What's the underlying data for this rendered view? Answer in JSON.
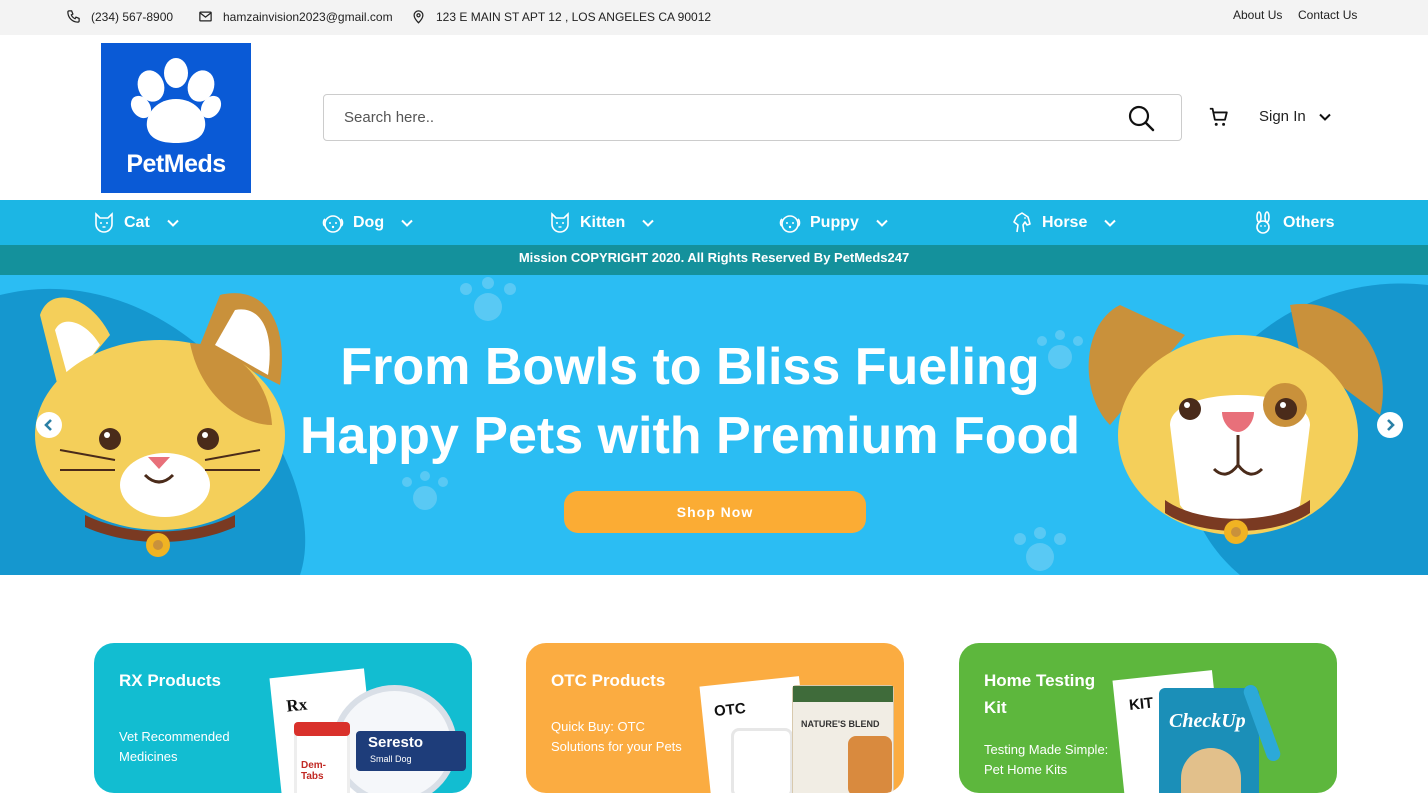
{
  "topbar": {
    "phone": "(234) 567-8900",
    "email": "hamzainvision2023@gmail.com",
    "address": "123 E MAIN ST APT 12 , LOS ANGELES CA 90012",
    "links": [
      "About Us",
      "Contact Us"
    ]
  },
  "header": {
    "logo_text": "PetMeds",
    "search_placeholder": "Search here..",
    "signin_label": "Sign In"
  },
  "nav": {
    "items": [
      {
        "label": "Cat",
        "icon": "cat-icon",
        "dropdown": true
      },
      {
        "label": "Dog",
        "icon": "dog-icon",
        "dropdown": true
      },
      {
        "label": "Kitten",
        "icon": "kitten-icon",
        "dropdown": true
      },
      {
        "label": "Puppy",
        "icon": "puppy-icon",
        "dropdown": true
      },
      {
        "label": "Horse",
        "icon": "horse-icon",
        "dropdown": true
      },
      {
        "label": "Others",
        "icon": "rabbit-icon",
        "dropdown": false
      }
    ]
  },
  "notice": "Mission COPYRIGHT 2020. All Rights Reserved By PetMeds247",
  "hero": {
    "title_line1": "From Bowls to Bliss Fueling",
    "title_line2": "Happy Pets with Premium Food",
    "button": "Shop Now"
  },
  "cards": [
    {
      "title": "RX Products",
      "desc": "Vet Recommended Medicines",
      "color": "#12bdd1",
      "label": "Rx",
      "product": "Seresto",
      "sub_product": "Small Dog",
      "bottle": "Dem-Tabs"
    },
    {
      "title": "OTC Products",
      "desc": "Quick Buy: OTC Solutions for your Pets",
      "color": "#fbac41",
      "label": "OTC",
      "product": "NATURE'S BLEND"
    },
    {
      "title": "Home Testing Kit",
      "desc": "Testing Made Simple: Pet Home Kits",
      "color": "#5db73d",
      "label": "KIT",
      "product": "CheckUp"
    }
  ],
  "colors": {
    "brand_blue": "#0a5ad6",
    "nav_bg": "#1cb6e4",
    "notice_bg": "#14919c",
    "hero_bg": "#2bbdf3",
    "cta": "#fbac34"
  }
}
